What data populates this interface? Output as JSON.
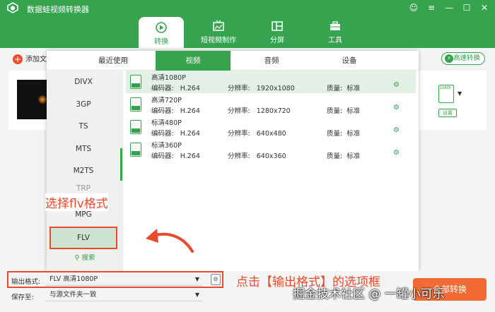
{
  "app": {
    "title": "数据蛙视频转换器"
  },
  "window_controls": {
    "items": [
      {
        "name": "user-icon",
        "glyph": "☺"
      },
      {
        "name": "menu-icon",
        "glyph": "≡"
      },
      {
        "name": "minimize-icon",
        "glyph": "—"
      },
      {
        "name": "maximize-icon",
        "glyph": "☐"
      },
      {
        "name": "close-icon",
        "glyph": "✕"
      }
    ]
  },
  "top_tabs": [
    {
      "label": "转换",
      "icon": "convert-icon",
      "active": true
    },
    {
      "label": "短视频制作",
      "icon": "tv-icon",
      "active": false
    },
    {
      "label": "分屏",
      "icon": "split-screen-icon",
      "active": false
    },
    {
      "label": "工具",
      "icon": "toolbox-icon",
      "active": false
    }
  ],
  "toolbar": {
    "add_file_label": "添加文件",
    "fast_convert_label": "高速转换"
  },
  "file_item": {
    "output_icon_label": "1080P",
    "settings_label": "设置"
  },
  "panel": {
    "tabs": [
      {
        "label": "最近使用",
        "active": false
      },
      {
        "label": "视频",
        "active": true
      },
      {
        "label": "音频",
        "active": false
      },
      {
        "label": "设备",
        "active": false
      }
    ],
    "formats": [
      "DIVX",
      "3GP",
      "TS",
      "MTS",
      "M2TS",
      "TRP",
      "MPG",
      "FLV"
    ],
    "selected_format": "FLV",
    "search_label": "搜索",
    "presets": [
      {
        "name": "高清1080P",
        "encoder_label": "编码器:",
        "encoder": "H.264",
        "res_label": "分辨率:",
        "resolution": "1920x1080",
        "quality_label": "质量:",
        "quality": "标准",
        "active": true
      },
      {
        "name": "高清720P",
        "encoder_label": "编码器:",
        "encoder": "H.264",
        "res_label": "分辨率:",
        "resolution": "1280x720",
        "quality_label": "质量:",
        "quality": "标准",
        "active": false
      },
      {
        "name": "标清480P",
        "encoder_label": "编码器:",
        "encoder": "H.264",
        "res_label": "分辨率:",
        "resolution": "640x480",
        "quality_label": "质量:",
        "quality": "标准",
        "active": false
      },
      {
        "name": "标清360P",
        "encoder_label": "编码器:",
        "encoder": "H.264",
        "res_label": "分辨率:",
        "resolution": "640x360",
        "quality_label": "质量:",
        "quality": "标准",
        "active": false
      }
    ],
    "preset_icon_labels": [
      "1080P",
      "720P",
      "480P",
      "360P"
    ]
  },
  "bottom": {
    "output_format_label": "输出格式:",
    "output_format_value": "FLV 高清1080P",
    "save_to_label": "保存至:",
    "save_to_value": "与源文件夹一致",
    "convert_label": "全部转换"
  },
  "annotations": {
    "select_flv": "选择flv格式",
    "click_output": "点击【输出格式】的选项框",
    "watermark": "掘金技术社区 @ 一罐小可乐"
  },
  "colors": {
    "brand_green": "#36a34f",
    "annotation_red": "#e84a2c",
    "convert_orange": "#f26b35"
  }
}
